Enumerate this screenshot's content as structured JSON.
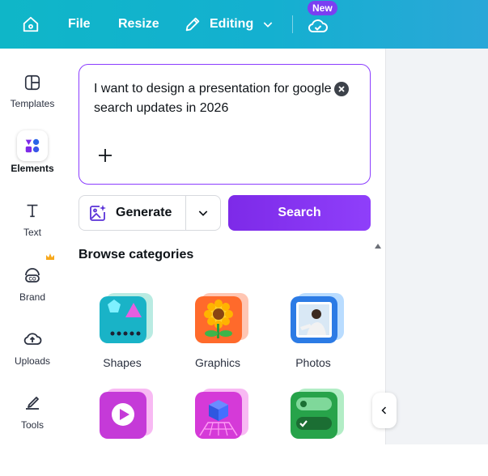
{
  "topbar": {
    "file_label": "File",
    "resize_label": "Resize",
    "mode_label": "Editing",
    "new_badge": "New"
  },
  "sidebar": {
    "items": [
      {
        "label": "Templates",
        "icon": "templates-icon"
      },
      {
        "label": "Elements",
        "icon": "elements-icon"
      },
      {
        "label": "Text",
        "icon": "text-icon"
      },
      {
        "label": "Brand",
        "icon": "brand-icon"
      },
      {
        "label": "Uploads",
        "icon": "uploads-icon"
      },
      {
        "label": "Tools",
        "icon": "tools-icon"
      }
    ]
  },
  "prompt": {
    "value": "I want to design a presentation for google search updates in 2026"
  },
  "actions": {
    "generate_label": "Generate",
    "search_label": "Search"
  },
  "browse": {
    "heading": "Browse categories",
    "categories": [
      {
        "label": "Shapes",
        "icon": "shapes-icon"
      },
      {
        "label": "Graphics",
        "icon": "graphics-icon"
      },
      {
        "label": "Photos",
        "icon": "photos-icon"
      },
      {
        "label": "",
        "icon": "videos-icon"
      },
      {
        "label": "",
        "icon": "3d-icon"
      },
      {
        "label": "",
        "icon": "ai-charts-icon"
      }
    ]
  },
  "colors": {
    "accent": "#8b3dff",
    "topbar": "#14b0d0",
    "badge": "#7a3ff2"
  }
}
